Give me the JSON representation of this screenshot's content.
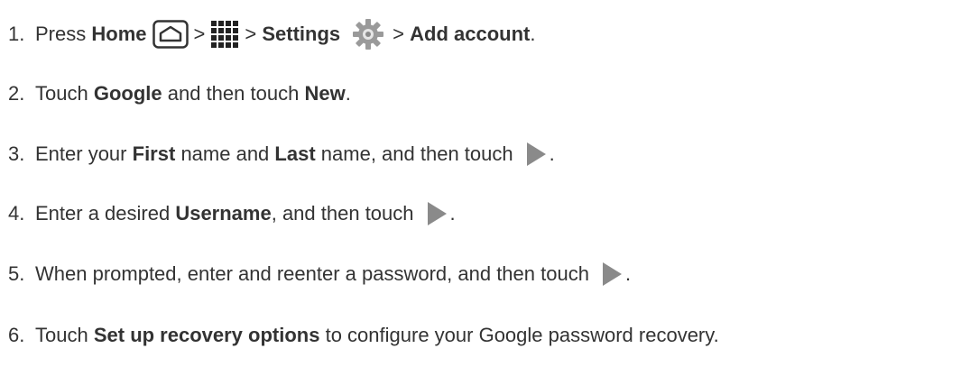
{
  "steps": [
    {
      "number": "1.",
      "text_press": "Press",
      "home": "Home",
      "sep1": ">",
      "sep2": ">",
      "settings": "Settings",
      "sep3": ">",
      "add_account": "Add account",
      "end": ".",
      "icons": [
        "home-icon",
        "apps-icon",
        "gear-icon"
      ]
    },
    {
      "number": "2.",
      "text_touch": "Touch",
      "google": "Google",
      "text_mid": "and then touch",
      "new": "New",
      "end": "."
    },
    {
      "number": "3.",
      "text_enter": "Enter your",
      "first": "First",
      "text_mid1": "name and",
      "last": "Last",
      "text_mid2": "name, and then touch",
      "end": ".",
      "icons": [
        "next-arrow-icon"
      ]
    },
    {
      "number": "4.",
      "text_enter": "Enter a desired",
      "username": "Username",
      "text_mid": ", and then touch",
      "end": ".",
      "icons": [
        "next-arrow-icon"
      ]
    },
    {
      "number": "5.",
      "text": "When prompted, enter and reenter a password, and then touch",
      "end": ".",
      "icons": [
        "next-arrow-icon"
      ]
    },
    {
      "number": "6.",
      "text_touch": "Touch",
      "recovery": "Set up recovery options",
      "text_rest": "to configure your Google password recovery."
    }
  ],
  "colors": {
    "text": "#333333",
    "icon_gray": "#8a8a8a",
    "background": "#ffffff"
  }
}
